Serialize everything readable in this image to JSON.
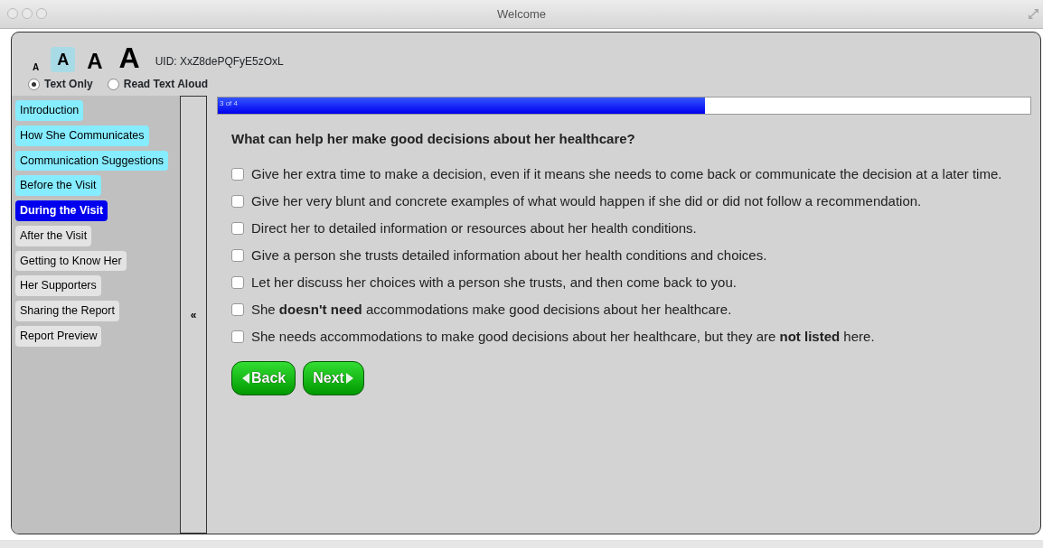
{
  "window": {
    "title": "Welcome"
  },
  "font_sizes": [
    {
      "label": "A",
      "selected": false
    },
    {
      "label": "A",
      "selected": true
    },
    {
      "label": "A",
      "selected": false
    },
    {
      "label": "A",
      "selected": false
    }
  ],
  "uid": "UID: XxZ8dePQFyE5zOxL",
  "modes": [
    {
      "label": "Text Only",
      "selected": true
    },
    {
      "label": "Read Text Aloud",
      "selected": false
    }
  ],
  "sidebar": {
    "items": [
      {
        "label": "Introduction",
        "visited": true,
        "selected": false
      },
      {
        "label": "How She Communicates",
        "visited": true,
        "selected": false
      },
      {
        "label": "Communication Suggestions",
        "visited": true,
        "selected": false
      },
      {
        "label": "Before the Visit",
        "visited": true,
        "selected": false
      },
      {
        "label": "During the Visit",
        "visited": false,
        "selected": true
      },
      {
        "label": "After the Visit",
        "visited": false,
        "selected": false
      },
      {
        "label": "Getting to Know Her",
        "visited": false,
        "selected": false
      },
      {
        "label": "Her Supporters",
        "visited": false,
        "selected": false
      },
      {
        "label": "Sharing the Report",
        "visited": false,
        "selected": false
      },
      {
        "label": "Report Preview",
        "visited": false,
        "selected": false
      }
    ],
    "collapse": "«"
  },
  "progress": {
    "label": "3 of 4",
    "level": 0.6
  },
  "question": "What can help her make good decisions about her healthcare?",
  "options": [
    {
      "label": "Give her extra time to make a decision, even if it means she needs to come back or communicate the decision at a later time.",
      "checked": false
    },
    {
      "label": "Give her very blunt and concrete examples of what would happen if she did or did not follow a recommendation.",
      "checked": false
    },
    {
      "label": "Direct her to detailed information or resources about her health conditions.",
      "checked": false
    },
    {
      "label": "Give a person she trusts detailed information about her health conditions and choices.",
      "checked": false
    },
    {
      "label": "Let her discuss her choices with a person she trusts, and then come back to you.",
      "checked": false
    },
    {
      "label": "She **doesn't need** accommodations make good decisions about her healthcare.",
      "checked": false
    },
    {
      "label": "She needs accommodations to make good decisions about her healthcare, but they are **not listed** here.",
      "checked": false
    }
  ],
  "buttons": [
    {
      "label": "Back",
      "kind": "back"
    },
    {
      "label": "Next",
      "kind": "next"
    }
  ]
}
